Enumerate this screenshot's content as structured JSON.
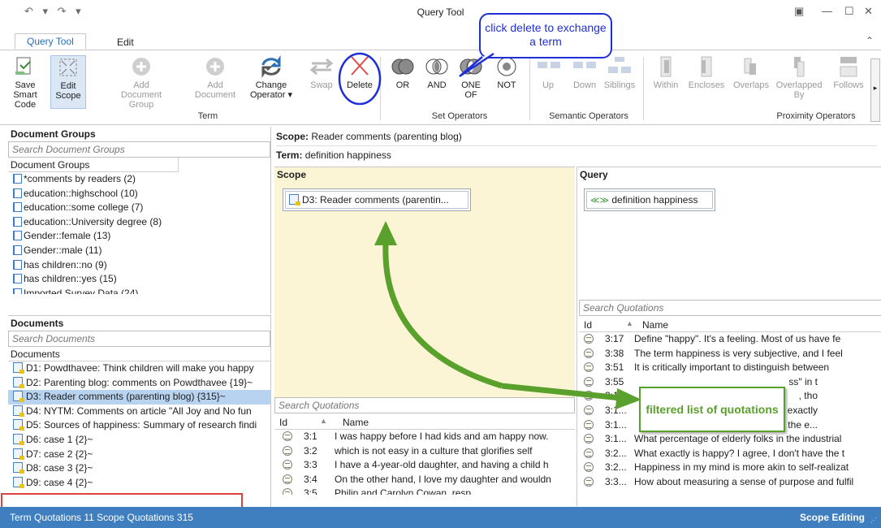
{
  "window": {
    "title": "Query Tool",
    "qat_symbols": "↶ ▾ ↷ ▾",
    "minimize": "—",
    "maximize": "☐",
    "close": "✕",
    "restore_icon": "▣",
    "collapse_ribbon": "⌃"
  },
  "tabs": [
    {
      "label": "Query Tool"
    },
    {
      "label": "Edit"
    }
  ],
  "ribbon": {
    "buttons": {
      "save_smart_code": "Save Smart Code",
      "edit_scope": "Edit Scope",
      "add_document_group": "Add Document Group",
      "add_document": "Add Document",
      "change_operator": "Change Operator ▾",
      "swap": "Swap",
      "delete": "Delete",
      "or": "OR",
      "and": "AND",
      "one_of": "ONE OF",
      "not": "NOT",
      "up": "Up",
      "down": "Down",
      "siblings": "Siblings",
      "within": "Within",
      "encloses": "Encloses",
      "overlaps": "Overlaps",
      "overlapped_by": "Overlapped By",
      "follows": "Follows"
    },
    "groups": {
      "term": "Term",
      "set_operators": "Set Operators",
      "semantic_operators": "Semantic Operators",
      "proximity_operators": "Proximity Operators"
    },
    "scroll_arrow": "▸"
  },
  "callouts": {
    "delete_note": "click delete to exchange a term",
    "filtered_note": "filtered list of quotations"
  },
  "document_groups": {
    "title": "Document Groups",
    "search_placeholder": "Search Document Groups",
    "column": "Document Groups",
    "items": [
      {
        "label": "*comments by readers (2)"
      },
      {
        "label": "education::highschool (10)"
      },
      {
        "label": "education::some college (7)"
      },
      {
        "label": "education::University degree (8)"
      },
      {
        "label": "Gender::female (13)"
      },
      {
        "label": "Gender::male (11)"
      },
      {
        "label": "has children::no (9)"
      },
      {
        "label": "has children::yes (15)"
      },
      {
        "label": "Imported Survey Data (24)"
      }
    ]
  },
  "documents": {
    "title": "Documents",
    "search_placeholder": "Search Documents",
    "column": "Documents",
    "items": [
      {
        "label": "D1: Powdthavee: Think children will make you happy"
      },
      {
        "label": "D2: Parenting blog: comments on Powdthavee {19}~"
      },
      {
        "label": "D3: Reader comments (parenting blog) {315}~"
      },
      {
        "label": "D4: NYTM: Comments on article \"All Joy and No fun"
      },
      {
        "label": "D5: Sources of happiness: Summary of research findi"
      },
      {
        "label": "D6: case 1 {2}~"
      },
      {
        "label": "D7: case 2 {2}~"
      },
      {
        "label": "D8: case 3 {2}~"
      },
      {
        "label": "D9: case 4 {2}~"
      }
    ]
  },
  "header": {
    "scope_label": "Scope:",
    "scope_value": "Reader comments (parenting blog)",
    "term_label": "Term:",
    "term_value": "definition happiness"
  },
  "scope_pane": {
    "title": "Scope",
    "node": "D3: Reader comments (parentin..."
  },
  "query_pane": {
    "title": "Query",
    "node_icon": "≪≫",
    "node": "definition happiness"
  },
  "scope_quotations": {
    "search_placeholder": "Search Quotations",
    "col_id": "Id",
    "col_name": "Name",
    "sort_arrow": "▲",
    "rows": [
      {
        "id": "3:1",
        "name": "I was happy before I had kids and am happy now."
      },
      {
        "id": "3:2",
        "name": "which is not easy in a culture that glorifies self"
      },
      {
        "id": "3:3",
        "name": "I have a 4-year-old daughter, and having a child h"
      },
      {
        "id": "3:4",
        "name": "On the other hand, I love my daughter and wouldn"
      },
      {
        "id": "3:5",
        "name": "Philip and Carolyn Cowan, resp"
      }
    ]
  },
  "query_quotations": {
    "search_placeholder": "Search Quotations",
    "col_id": "Id",
    "col_name": "Name",
    "sort_arrow": "▲",
    "rows": [
      {
        "id": "3:17",
        "name": "Define \"happy\". It's a feeling. Most of us have fe"
      },
      {
        "id": "3:38",
        "name": "The term happiness is very subjective, and I feel"
      },
      {
        "id": "3:51",
        "name": "It is critically important to distinguish between"
      },
      {
        "id": "3:55",
        "name": "ss\" in t"
      },
      {
        "id": "3:1...",
        "name": ", tho"
      },
      {
        "id": "3:1...",
        "name": "at exactly"
      },
      {
        "id": "3:1...",
        "name": "ed the e..."
      },
      {
        "id": "3:1...",
        "name": "What percentage of elderly folks in the industrial"
      },
      {
        "id": "3:2...",
        "name": "What exactly is happy? I agree, I don't have the t"
      },
      {
        "id": "3:2...",
        "name": "Happiness in my mind is more akin to self-realizat"
      },
      {
        "id": "3:3...",
        "name": "How about measuring a sense of purpose and fulfil"
      }
    ]
  },
  "status": {
    "left": "Term Quotations 11 Scope Quotations 315",
    "right": "Scope Editing"
  },
  "colors": {
    "accent": "#2a6fb7",
    "status_bar": "#3f7ebf",
    "scope_bg": "#fbf5d6",
    "callout_border_blue": "#1f2fd6",
    "callout_border_green": "#5aa02c",
    "arrow_green": "#5aa02c",
    "highlight_red": "#e04040"
  }
}
